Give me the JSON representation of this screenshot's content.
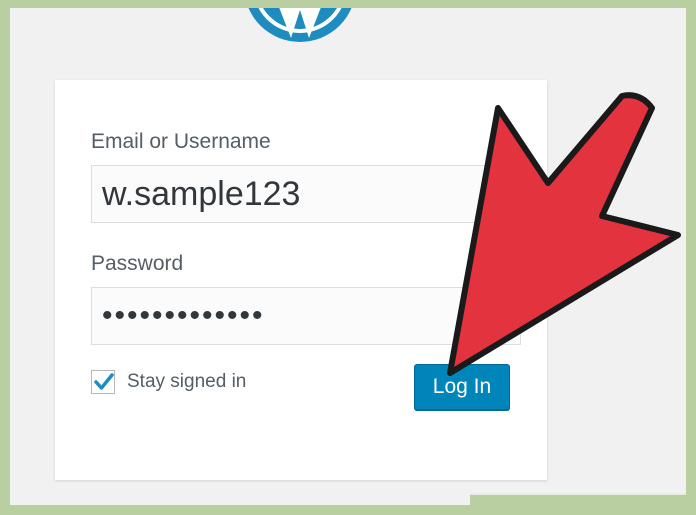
{
  "form": {
    "email_label": "Email or Username",
    "email_value": "w.sample123",
    "password_label": "Password",
    "password_masked": "•••••••••••••",
    "remember_label": "Stay signed in",
    "remember_checked": true,
    "login_label": "Log In"
  },
  "icons": [
    "wordpress-logo-icon",
    "checkmark-icon",
    "arrow-annotation-icon"
  ],
  "colors": {
    "frame": "#b9cfa2",
    "page_bg": "#f1f1f1",
    "button": "#0085ba",
    "logo": "#1e8cbe",
    "arrow": "#e2333f"
  }
}
